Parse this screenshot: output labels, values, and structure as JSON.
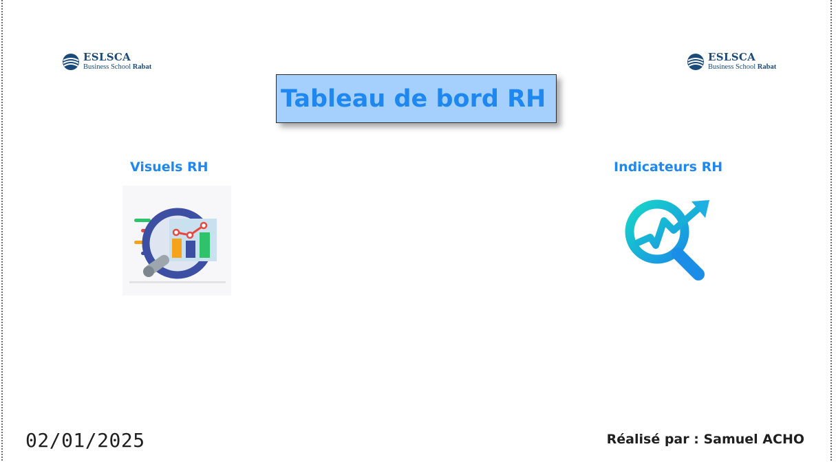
{
  "header": {
    "logo_brand": "ESLSCA",
    "logo_sub_prefix": "Business School ",
    "logo_sub_city": "Rabat",
    "title": "Tableau de bord RH"
  },
  "sections": {
    "visuels": {
      "label": "Visuels RH",
      "icon": "analytics-magnifier-chart-icon"
    },
    "indicateurs": {
      "label": "Indicateurs RH",
      "icon": "trend-search-icon"
    }
  },
  "footer": {
    "date": "02/01/2025",
    "author": "Réalisé par : Samuel ACHO"
  },
  "colors": {
    "accent": "#1e88f0",
    "title_bg": "#a5cffc",
    "logo": "#1a4a7a",
    "teal": "#16c9d6"
  }
}
